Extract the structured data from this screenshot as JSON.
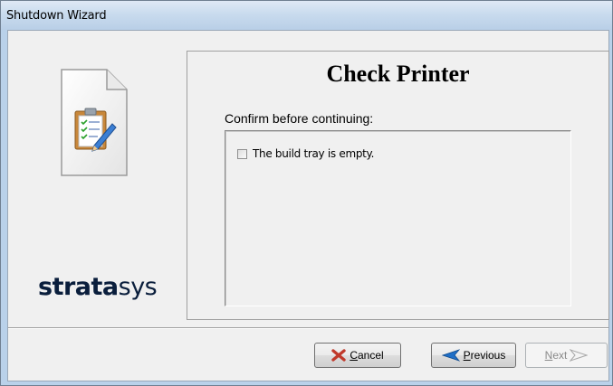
{
  "window": {
    "title": "Shutdown Wizard"
  },
  "sidebar": {
    "brand_bold": "strata",
    "brand_light": "sys"
  },
  "page": {
    "heading": "Check Printer",
    "prompt": "Confirm before continuing:",
    "checks": [
      {
        "label": "The build tray is empty.",
        "checked": false
      }
    ]
  },
  "buttons": {
    "cancel": {
      "mnemonic": "C",
      "rest": "ancel",
      "enabled": true
    },
    "previous": {
      "mnemonic": "P",
      "rest": "revious",
      "enabled": true
    },
    "next": {
      "mnemonic": "N",
      "rest": "ext",
      "enabled": false
    }
  },
  "colors": {
    "cancel_icon": "#c0392b",
    "previous_icon": "#1f6fc7",
    "brand": "#0a1e3c"
  }
}
